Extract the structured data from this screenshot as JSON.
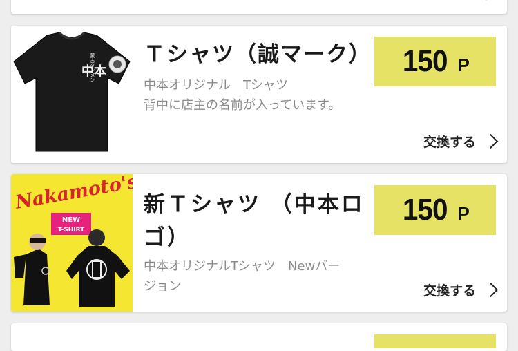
{
  "items": [
    {
      "title": "Ｔシャツ（誠マーク）",
      "desc_lines": [
        "中本オリジナル　Tシャツ",
        "背中に店主の名前が入っています。"
      ],
      "price_value": "150",
      "price_unit": "P",
      "exchange_label": "交換する",
      "image_text": {
        "vertical": "蒙古タンメン",
        "logo": "中本"
      }
    },
    {
      "title_lines": [
        "新Ｔシャツ （中本ロ",
        "ゴ）"
      ],
      "desc_lines": [
        "中本オリジナルTシャツ　Newバー",
        "ジョン"
      ],
      "price_value": "150",
      "price_unit": "P",
      "exchange_label": "交換する",
      "image_text": {
        "brand": "Nakamoto's",
        "badge_top": "NEW",
        "badge_bottom": "T-SHIRT"
      }
    }
  ],
  "colors": {
    "price_bg": "#e6e265",
    "poster_yellow": "#f5e631",
    "brand_red": "#d9232e",
    "badge_pink": "#e5227c"
  }
}
